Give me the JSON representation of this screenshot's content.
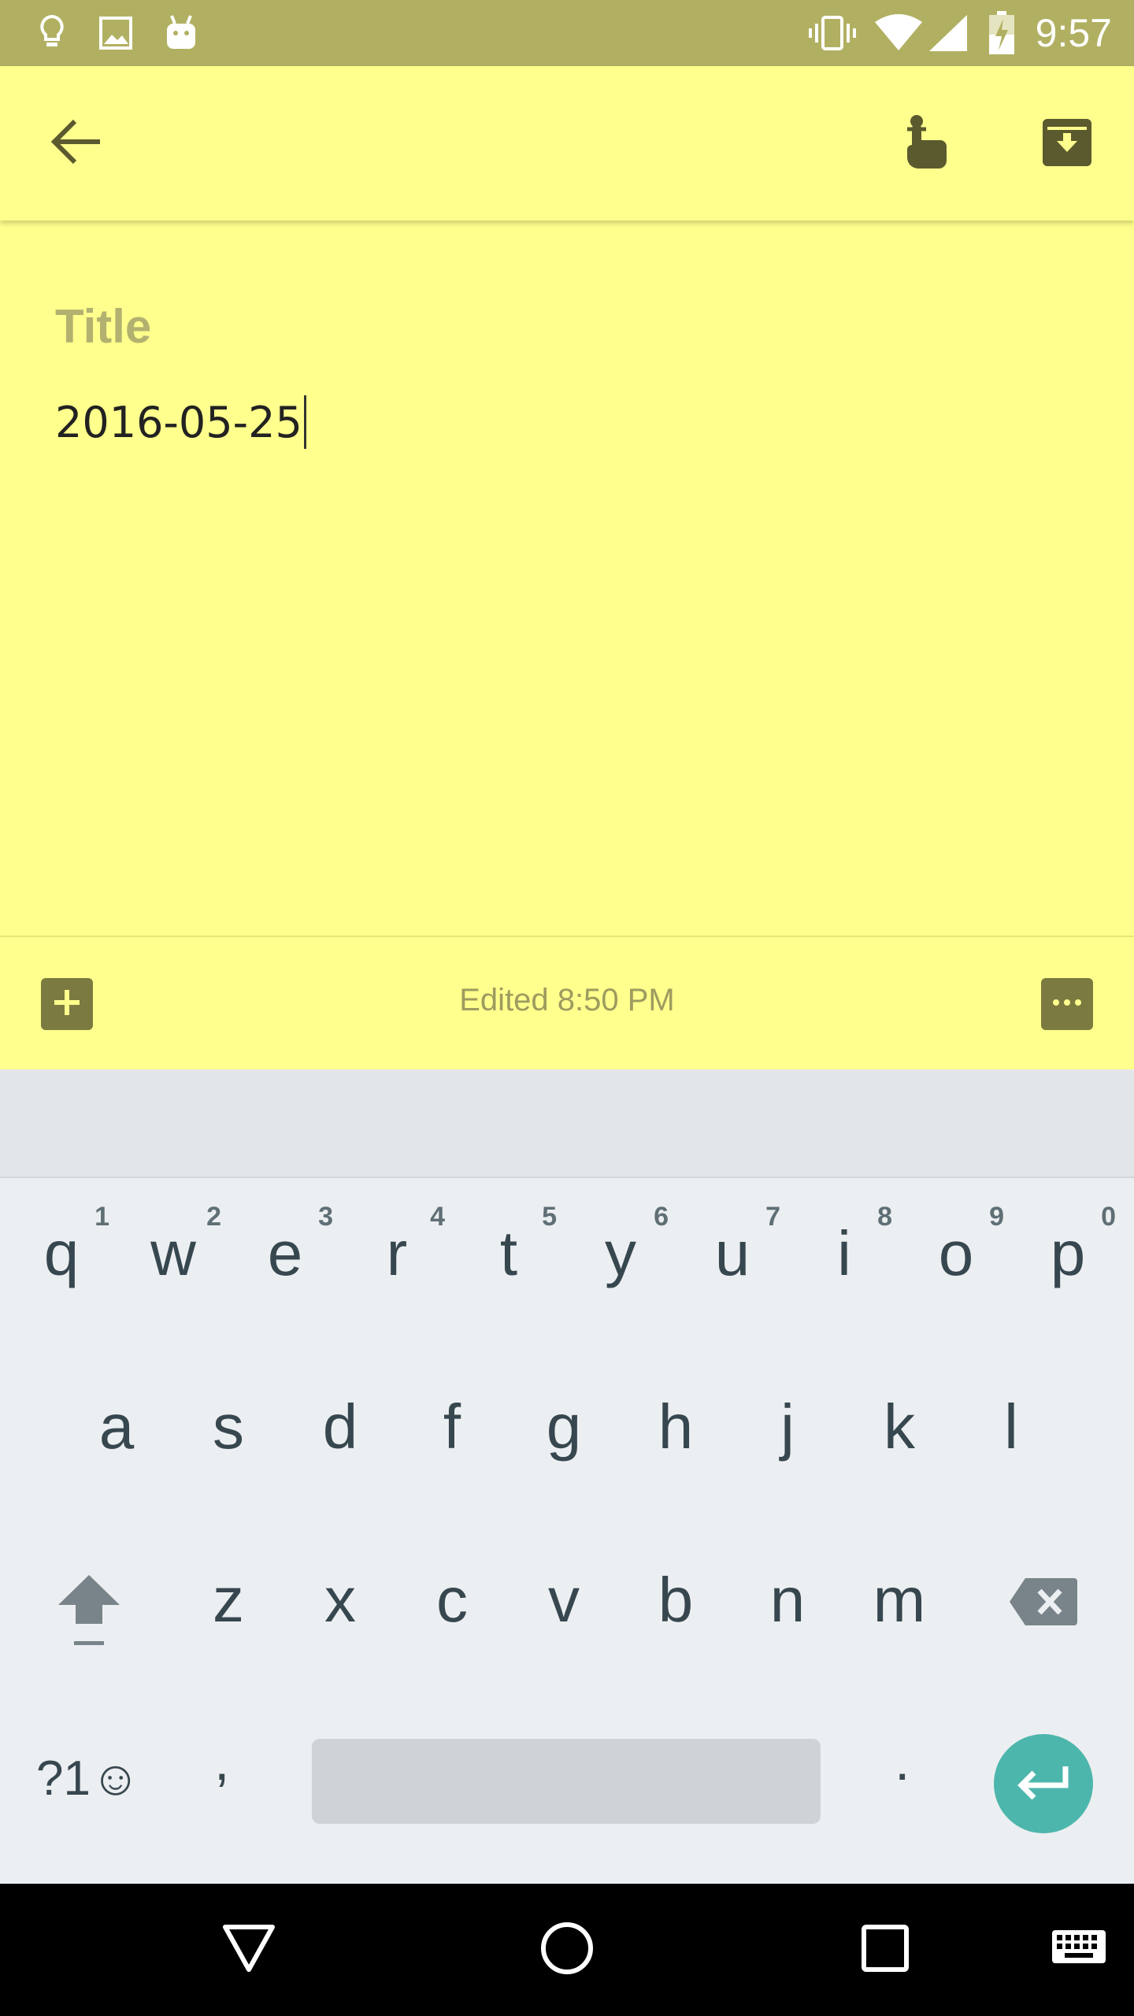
{
  "status_bar": {
    "time": "9:57",
    "left_icons": [
      "lightbulb-icon",
      "image-icon",
      "android-icon"
    ],
    "right_icons": [
      "vibrate-icon",
      "wifi-icon",
      "signal-icon",
      "battery-charging-icon"
    ]
  },
  "toolbar": {
    "back_icon": "arrow-back-icon",
    "reminder_icon": "reminder-finger-icon",
    "archive_icon": "archive-icon"
  },
  "note": {
    "title_placeholder": "Title",
    "body_text": "2016-05-25"
  },
  "footer": {
    "edited_status": "Edited 8:50 PM",
    "add_icon": "add-box-icon",
    "more_icon": "more-horizontal-icon"
  },
  "keyboard": {
    "row1": [
      {
        "letter": "q",
        "hint": "1"
      },
      {
        "letter": "w",
        "hint": "2"
      },
      {
        "letter": "e",
        "hint": "3"
      },
      {
        "letter": "r",
        "hint": "4"
      },
      {
        "letter": "t",
        "hint": "5"
      },
      {
        "letter": "y",
        "hint": "6"
      },
      {
        "letter": "u",
        "hint": "7"
      },
      {
        "letter": "i",
        "hint": "8"
      },
      {
        "letter": "o",
        "hint": "9"
      },
      {
        "letter": "p",
        "hint": "0"
      }
    ],
    "row2": [
      "a",
      "s",
      "d",
      "f",
      "g",
      "h",
      "j",
      "k",
      "l"
    ],
    "row3": [
      "z",
      "x",
      "c",
      "v",
      "b",
      "n",
      "m"
    ],
    "symbols_label": "?1☺",
    "comma": ",",
    "period": "."
  },
  "colors": {
    "note_background": "#ffff8d",
    "status_bar": "#b1b062",
    "accent_enter": "#4db6ac",
    "icon_olive": "#7b7a41"
  }
}
